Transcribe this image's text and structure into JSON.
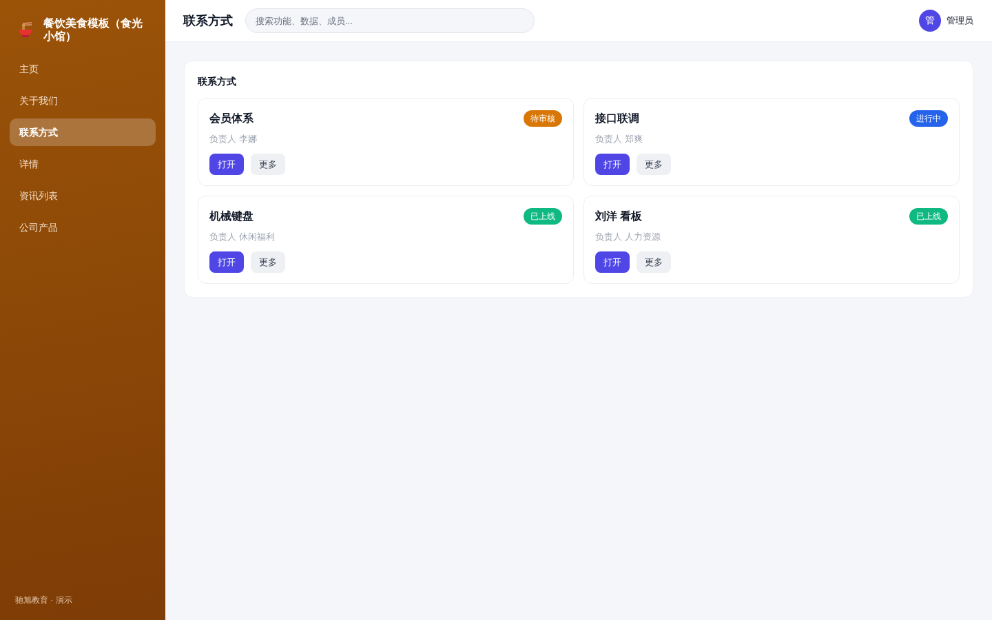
{
  "sidebar": {
    "brand": "餐饮美食模板（食光小馆）",
    "items": [
      {
        "label": "主页",
        "selected": false
      },
      {
        "label": "关于我们",
        "selected": false
      },
      {
        "label": "联系方式",
        "selected": true
      },
      {
        "label": "详情",
        "selected": false
      },
      {
        "label": "资讯列表",
        "selected": false
      },
      {
        "label": "公司产品",
        "selected": false
      }
    ],
    "footer": "驰旭教育 · 演示"
  },
  "header": {
    "title": "联系方式",
    "search": {
      "placeholder": "搜索功能、数据、成员..."
    },
    "user": {
      "avatar": "管",
      "name": "管理员"
    }
  },
  "panel": {
    "title": "联系方式",
    "cards": [
      {
        "title": "会员体系",
        "status": {
          "label": "待审核",
          "color": "#d97706"
        },
        "owner": "负责人 李娜",
        "actions": [
          {
            "label": "打开",
            "kind": "primary"
          },
          {
            "label": "更多",
            "kind": "secondary"
          }
        ]
      },
      {
        "title": "接口联调",
        "status": {
          "label": "进行中",
          "color": "#2563eb"
        },
        "owner": "负责人 郑爽",
        "actions": [
          {
            "label": "打开",
            "kind": "primary"
          },
          {
            "label": "更多",
            "kind": "secondary"
          }
        ]
      },
      {
        "title": "机械键盘",
        "status": {
          "label": "已上线",
          "color": "#10b981"
        },
        "owner": "负责人 休闲福利",
        "actions": [
          {
            "label": "打开",
            "kind": "primary"
          },
          {
            "label": "更多",
            "kind": "secondary"
          }
        ]
      },
      {
        "title": "刘洋 看板",
        "status": {
          "label": "已上线",
          "color": "#10b981"
        },
        "owner": "负责人 人力资源",
        "actions": [
          {
            "label": "打开",
            "kind": "primary"
          },
          {
            "label": "更多",
            "kind": "secondary"
          }
        ]
      }
    ]
  }
}
